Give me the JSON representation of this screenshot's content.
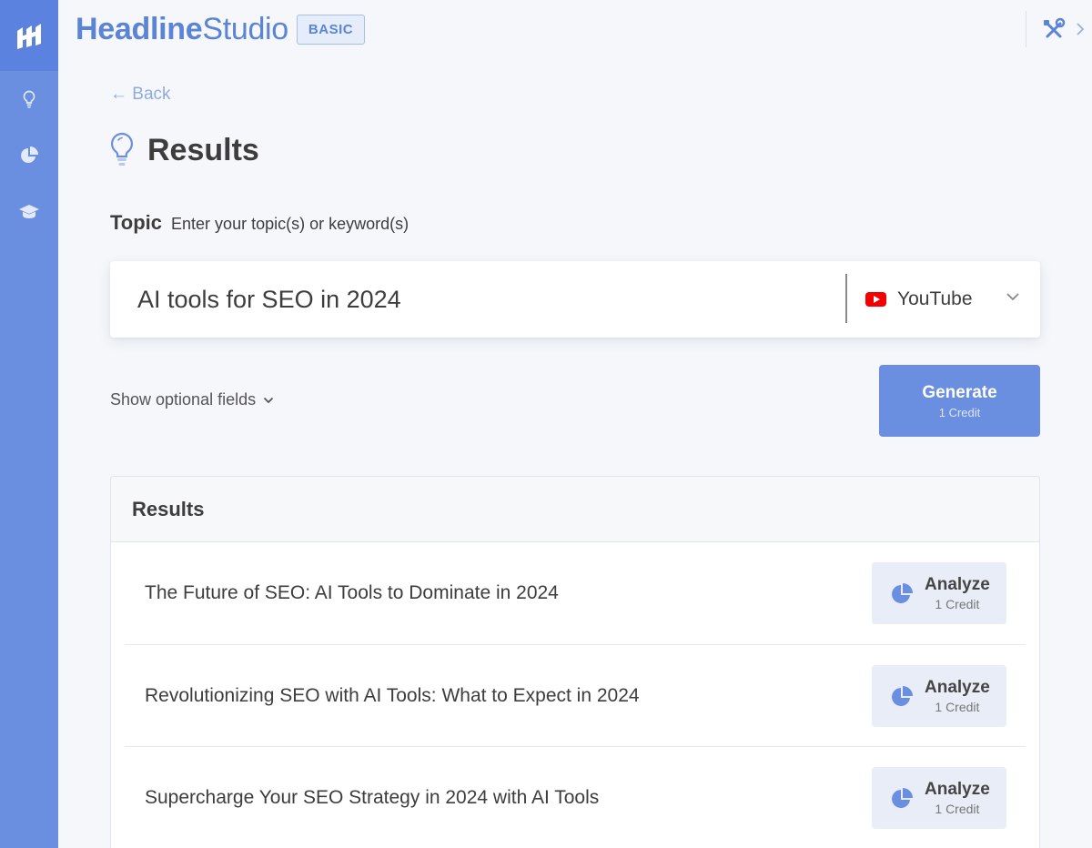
{
  "brand": {
    "part1": "Headline",
    "part2": "Studio",
    "plan": "BASIC"
  },
  "nav": {
    "back_label": "← Back"
  },
  "page": {
    "title": "Results"
  },
  "topic": {
    "label": "Topic",
    "hint": "Enter your topic(s) or keyword(s)",
    "value": "AI tools for SEO in 2024",
    "platform": "YouTube"
  },
  "optional_fields_label": "Show optional fields",
  "generate": {
    "label": "Generate",
    "cost": "1 Credit"
  },
  "results": {
    "heading": "Results",
    "items": [
      {
        "headline": "The Future of SEO: AI Tools to Dominate in 2024",
        "action": "Analyze",
        "cost": "1 Credit"
      },
      {
        "headline": "Revolutionizing SEO with AI Tools: What to Expect in 2024",
        "action": "Analyze",
        "cost": "1 Credit"
      },
      {
        "headline": "Supercharge Your SEO Strategy in 2024 with AI Tools",
        "action": "Analyze",
        "cost": "1 Credit"
      }
    ]
  },
  "icons": {
    "logo": "headline-studio-logo",
    "sidebar": [
      "lightbulb-icon",
      "pie-chart-icon",
      "graduation-cap-icon"
    ],
    "tools": "tools-icon"
  },
  "colors": {
    "accent": "#6b8fe0",
    "sidebar_logo_bg": "#5a82de",
    "brand_text": "#5b84d6",
    "youtube_red": "#f40000"
  }
}
